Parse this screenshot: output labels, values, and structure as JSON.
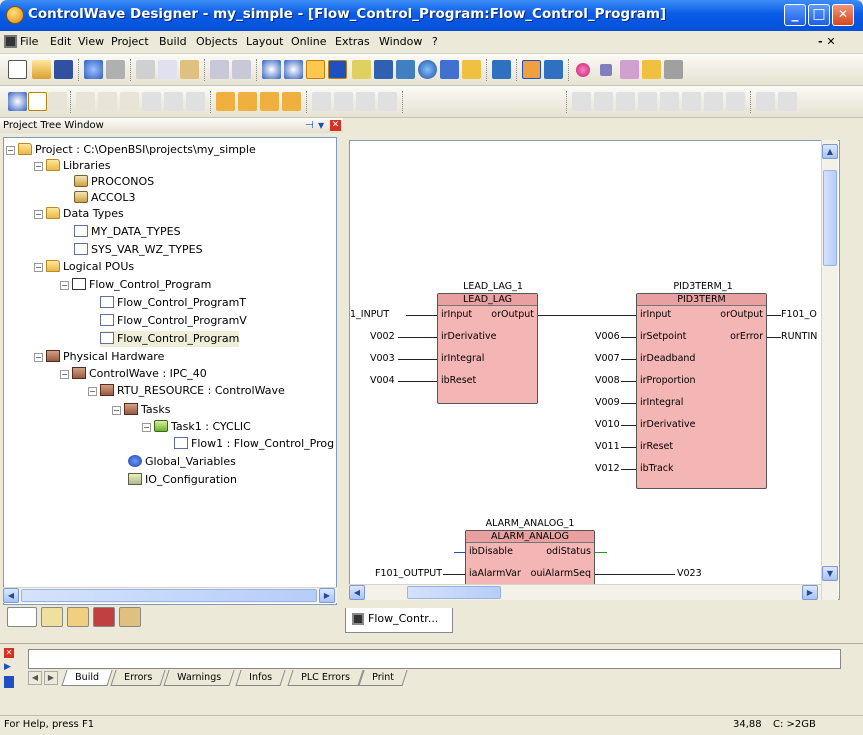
{
  "window": {
    "title": "ControlWave Designer - my_simple - [Flow_Control_Program:Flow_Control_Program]",
    "min": "_",
    "max": "□",
    "close": "✕"
  },
  "menu": {
    "items": [
      "File",
      "Edit",
      "View",
      "Project",
      "Build",
      "Objects",
      "Layout",
      "Online",
      "Extras",
      "Window",
      "?"
    ],
    "doc_controls": "- ✕"
  },
  "project_tree": {
    "title": "Project Tree Window",
    "nodes": [
      "Project : C:\\OpenBSI\\projects\\my_simple",
      "Libraries",
      "PROCONOS",
      "ACCOL3",
      "Data Types",
      "MY_DATA_TYPES",
      "SYS_VAR_WZ_TYPES",
      "Logical POUs",
      "Flow_Control_Program",
      "Flow_Control_ProgramT",
      "Flow_Control_ProgramV",
      "Flow_Control_Program",
      "Physical Hardware",
      "ControlWave : IPC_40",
      "RTU_RESOURCE : ControlWave",
      "Tasks",
      "Task1 : CYCLIC",
      "Flow1 : Flow_Control_Prog",
      "Global_Variables",
      "IO_Configuration"
    ]
  },
  "diagram": {
    "lead_lag": {
      "instance": "LEAD_LAG_1",
      "type": "LEAD_LAG",
      "inputs": [
        "irInput",
        "irDerivative",
        "irIntegral",
        "ibReset"
      ],
      "output": "orOutput",
      "in_vars": [
        "1_INPUT",
        "V002",
        "V003",
        "V004"
      ]
    },
    "pid": {
      "instance": "PID3TERM_1",
      "type": "PID3TERM",
      "inputs": [
        "irInput",
        "irSetpoint",
        "irDeadband",
        "irProportion",
        "irIntegral",
        "irDerivative",
        "irReset",
        "ibTrack"
      ],
      "outputs": [
        "orOutput",
        "orError"
      ],
      "in_vars": [
        "V006",
        "V007",
        "V008",
        "V009",
        "V010",
        "V011",
        "V012"
      ],
      "out_vars": [
        "F101_O",
        "RUNTIN"
      ]
    },
    "alarm": {
      "instance": "ALARM_ANALOG_1",
      "type": "ALARM_ANALOG",
      "inputs": [
        "ibDisable",
        "iaAlarmVar"
      ],
      "outputs": [
        "odiStatus",
        "ouiAlarmSeq"
      ],
      "in_var": "F101_OUTPUT",
      "out_var": "V023"
    }
  },
  "doc_tab": "Flow_Contr...",
  "messages": {
    "tabs": [
      "Build",
      "Errors",
      "Warnings",
      "Infos",
      "PLC Errors",
      "Print"
    ]
  },
  "status": {
    "help": "For Help, press F1",
    "pos": "34,88",
    "disk": "C: >2GB"
  }
}
